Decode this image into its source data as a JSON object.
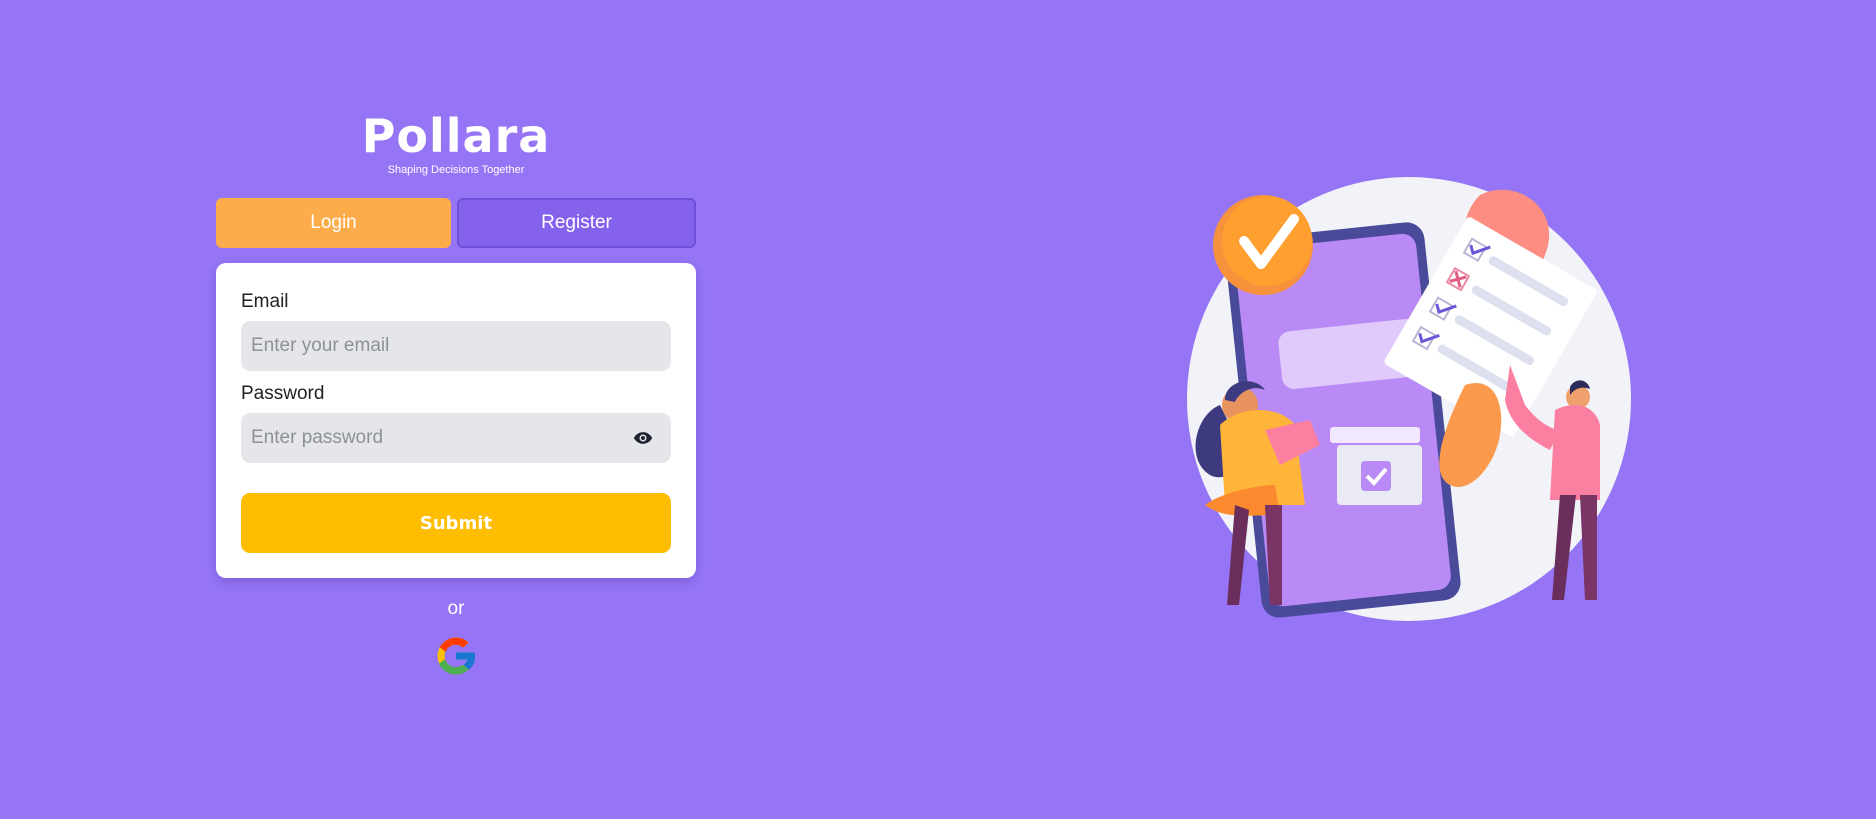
{
  "brand": {
    "name": "Pollara",
    "tagline": "Shaping Decisions Together"
  },
  "tabs": {
    "login": "Login",
    "register": "Register"
  },
  "form": {
    "email_label": "Email",
    "email_placeholder": "Enter your email",
    "password_label": "Password",
    "password_placeholder": "Enter password",
    "submit_label": "Submit"
  },
  "alt": {
    "or_text": "or",
    "google_icon": "google-icon"
  },
  "icons": {
    "password_toggle": "eye-icon"
  },
  "colors": {
    "background": "#9575f5",
    "login_tab": "#fcac4b",
    "register_tab": "#8462ec",
    "submit": "#ffbd00",
    "input_bg": "#e5e6ea"
  }
}
